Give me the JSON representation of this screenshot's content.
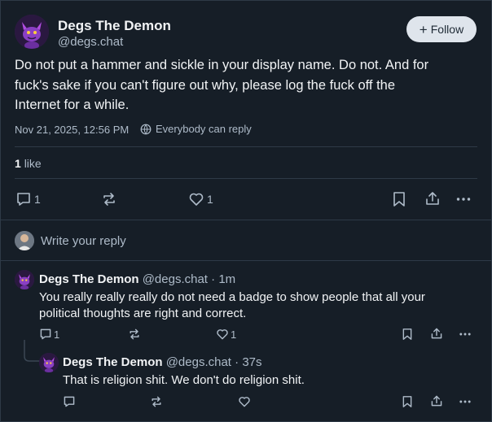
{
  "post": {
    "author_name": "Degs The Demon",
    "author_handle": "@degs.chat",
    "follow_label": "Follow",
    "text_lines": [
      "Do not put a hammer and sickle in your display name. Do not. And for",
      "fuck's sake if you can't figure out why, please log the fuck off the",
      "Internet for a while."
    ],
    "timestamp": "Nov 21, 2025, 12:56 PM",
    "reply_setting": "Everybody can reply",
    "likes_count": "1",
    "likes_label": "like",
    "reply_count": "1",
    "like_count": "1"
  },
  "composer": {
    "placeholder": "Write your reply"
  },
  "replies": [
    {
      "author_name": "Degs The Demon",
      "author_handle": "@degs.chat",
      "age": "· 1m",
      "text_lines": [
        "You really really really do not need a badge to show people that all your",
        "political thoughts are right and correct."
      ],
      "reply_count": "1",
      "like_count": "1"
    },
    {
      "author_name": "Degs The Demon",
      "author_handle": "@degs.chat",
      "age": "· 37s",
      "text_lines": [
        "That is religion shit. We don't do religion shit."
      ]
    }
  ],
  "colors": {
    "background": "#161e27",
    "border": "#2e3a47",
    "muted_text": "#aebbc9",
    "follow_button": "#dfe5ec",
    "avatar_purple": "#8a3fc4"
  },
  "icons": [
    "avatar-demon-icon",
    "plus-icon",
    "globe-icon",
    "reply-icon",
    "repost-icon",
    "heart-icon",
    "bookmark-icon",
    "share-icon",
    "more-icon"
  ]
}
